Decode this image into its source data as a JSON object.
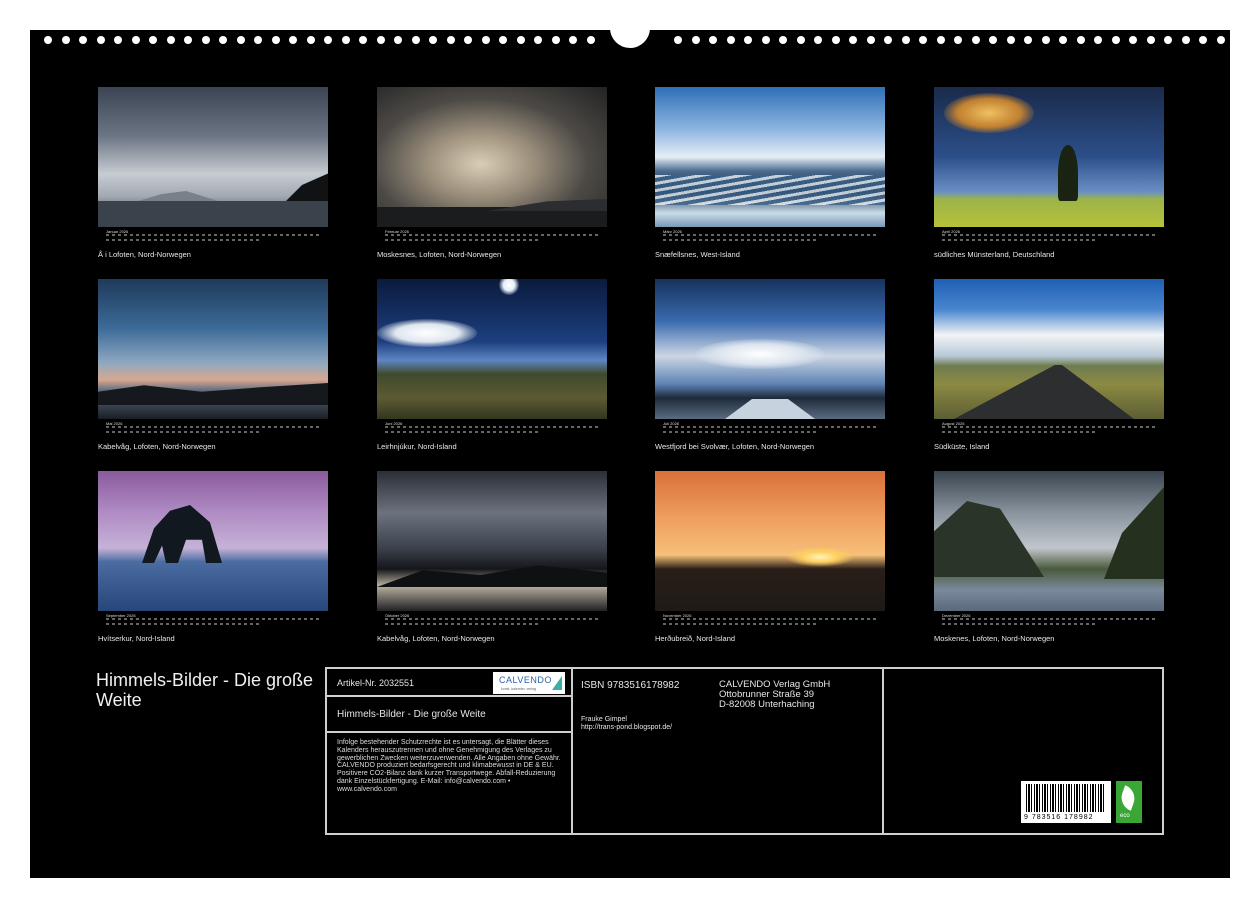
{
  "months": [
    {
      "label": "Januar 2026",
      "caption": "Å i Lofoten, Nord-Norwegen"
    },
    {
      "label": "Februar 2026",
      "caption": "Moskesnes, Lofoten, Nord-Norwegen"
    },
    {
      "label": "März 2026",
      "caption": "Snæfellsnes, West-Island"
    },
    {
      "label": "April 2026",
      "caption": "südliches Münsterland, Deutschland"
    },
    {
      "label": "Mai 2026",
      "caption": "Kabelvåg, Lofoten, Nord-Norwegen"
    },
    {
      "label": "Juni 2026",
      "caption": "Leirhnjúkur, Nord-Island"
    },
    {
      "label": "Juli 2026",
      "caption": "Westfjord bei Svolvær, Lofoten, Nord-Norwegen"
    },
    {
      "label": "August 2026",
      "caption": "Südküste, Island"
    },
    {
      "label": "September 2026",
      "caption": "Hvítserkur, Nord-Island"
    },
    {
      "label": "Oktober 2026",
      "caption": "Kabelvåg, Lofoten, Nord-Norwegen"
    },
    {
      "label": "November 2026",
      "caption": "Herðubreið, Nord-Island"
    },
    {
      "label": "Dezember 2026",
      "caption": "Moskenes, Lofoten, Nord-Norwegen"
    }
  ],
  "title": "Himmels-Bilder - Die große Weite",
  "info": {
    "article": "Artikel-Nr. 2032551",
    "logo_text": "CALVENDO",
    "logo_sub": "kunst. kalender. verlag",
    "product_title": "Himmels-Bilder - Die große Weite",
    "legal": "Infolge bestehender Schutzrechte ist es untersagt, die Blätter dieses Kalenders herauszutrennen und ohne Genehmigung des Verlages zu gewerblichen Zwecken weiterzuverwenden. Alle Angaben ohne Gewähr. CALVENDO produziert bedarfsgerecht und klimabewusst in DE & EU. Positivere CO2-Bilanz dank kurzer Transportwege. Abfall-Reduzierung dank Einzelstückfertigung. E-Mail: info@calvendo.com • www.calvendo.com",
    "isbn": "ISBN 9783516178982",
    "publisher_name": "CALVENDO Verlag GmbH",
    "publisher_street": "Ottobrunner Straße 39",
    "publisher_city": "D-82008 Unterhaching",
    "author": "Frauke Gimpel",
    "author_url": "http://trans-pond.blogspot.de/",
    "barcode_number": "9 783516 178982",
    "eco_label": "eco"
  }
}
